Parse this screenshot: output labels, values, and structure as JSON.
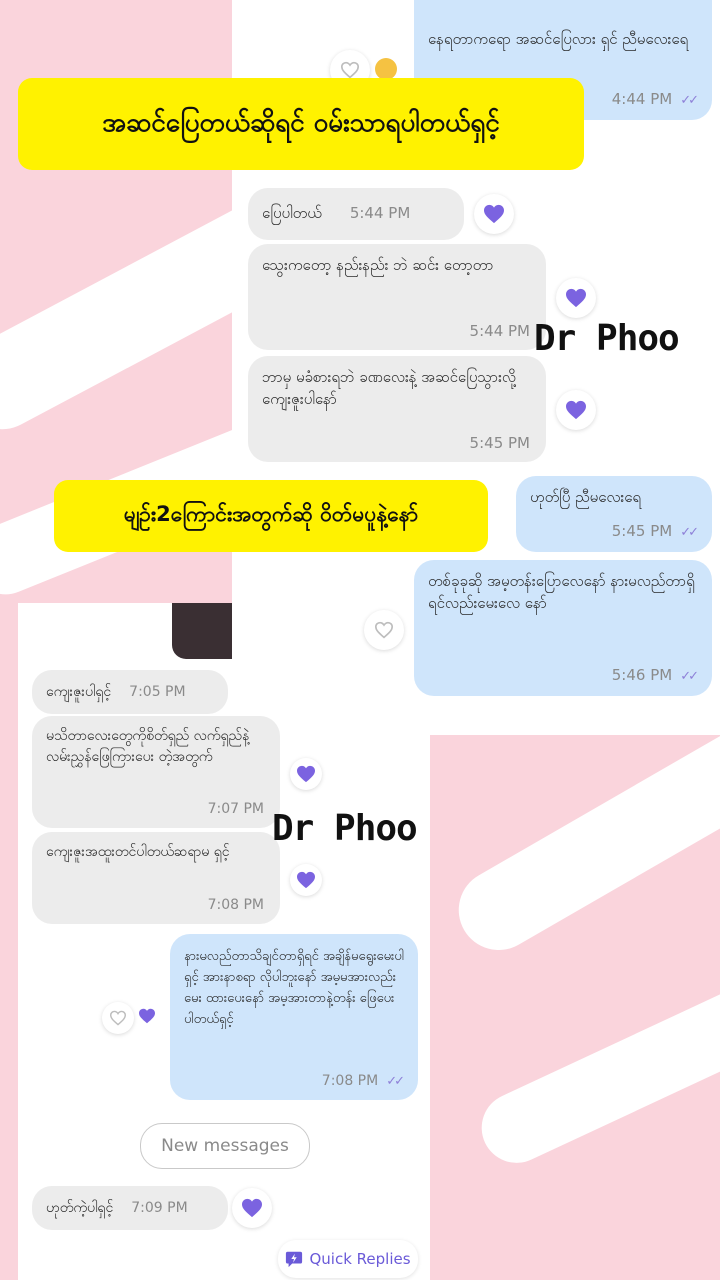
{
  "banners": {
    "top": "အဆင်ပြေတယ်ဆိုရင် ဝမ်းသာရပါတယ်ရှင့်",
    "middle": "မျဉ်း2ကြောင်းအတွက်ဆို ဝိတ်မပူနဲ့နော်"
  },
  "watermark": "Dr Phoo",
  "chat_top": {
    "messages": [
      {
        "text": "နေရတာကရော အဆင်ပြေလား ရှင် ညီမလေးရေ",
        "time": "4:44 PM",
        "status": "Read"
      },
      {
        "text": "ပြေပါတယ်",
        "time": "5:44 PM"
      },
      {
        "text": "သွေးကတော့ နည်းနည်း ဘဲ ဆင်း တော့တာ",
        "time": "5:44 PM"
      },
      {
        "text": "ဘာမှ မခံစားရဘဲ ခဏလေးနဲ့ အဆင်ပြေသွားလို့ ကျေးဇူးပါနော်",
        "time": "5:45 PM"
      },
      {
        "text": "ဟုတ်ပြီ ညီမလေးရေ",
        "time": "5:45 PM"
      },
      {
        "text": "တစ်ခုခုဆို အမ့တန်းပြောလေနော် နားမလည်တာရှိရင်လည်းမေးလေ နော်",
        "time": "5:46 PM"
      }
    ]
  },
  "chat_bottom": {
    "messages": [
      {
        "text": "ကျေးဇူးပါရှင့်",
        "time": "7:05 PM"
      },
      {
        "text": "မသိတာလေးတွေကိုစိတ်ရှည် လက်ရှည်နဲ့လမ်းညွှန်ဖြေကြားပေး တဲ့အတွက်",
        "time": "7:07 PM"
      },
      {
        "text": "ကျေးဇူးအထူးတင်ပါတယ်ဆရာမ ရှင့်",
        "time": "7:08 PM"
      },
      {
        "text": "နားမလည်တာသိချင်တာရှိရင် အချိန်မရွေးမေးပါရှင့် အားနာစရာ လိုပါဘူးနော် အမ့မအားလည်းမေး ထားပေးနော် အမ့အားတာနဲ့တန်း ဖြေပေးပါတယ်ရှင့်",
        "time": "7:08 PM"
      },
      {
        "text": "ဟုတ်ကဲ့ပါရှင့်",
        "time": "7:09 PM"
      }
    ],
    "new_messages_label": "New messages",
    "quick_replies_label": "Quick Replies"
  },
  "colors": {
    "banner": "#fff200",
    "incoming_bubble": "#ececec",
    "outgoing_bubble": "#cfe5fb",
    "heart": "#7b63e0",
    "background": "#fad4dc"
  },
  "icons": [
    "heart-icon",
    "heart-outline-icon",
    "double-check-icon",
    "quick-replies-icon",
    "thumbs-up-icon"
  ]
}
